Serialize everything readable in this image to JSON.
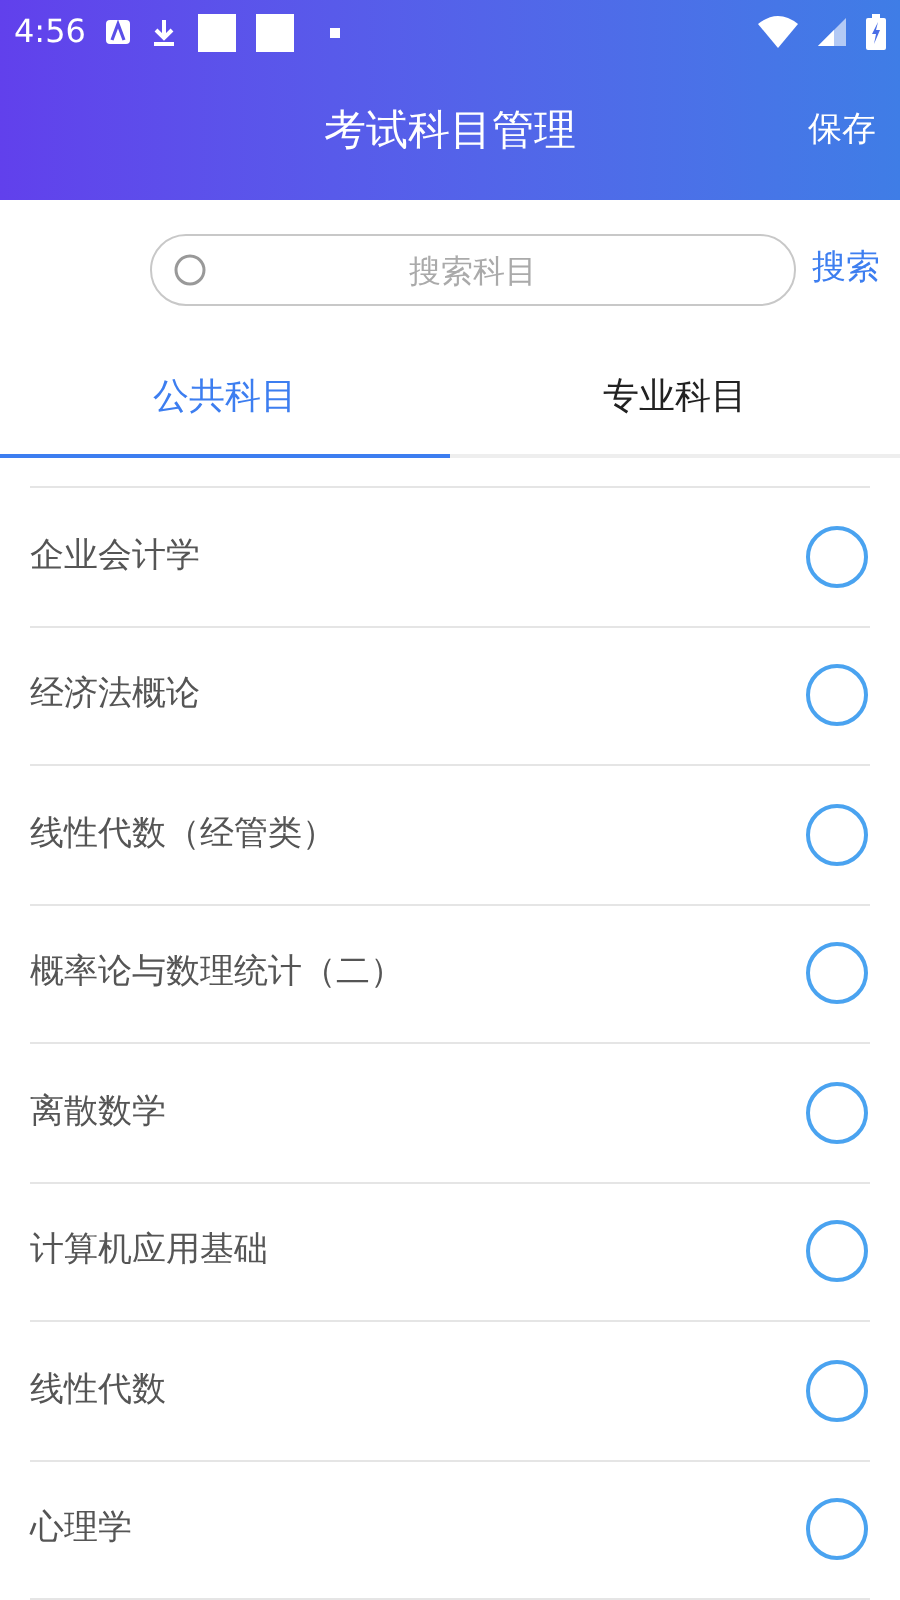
{
  "status_bar": {
    "time": "4:56"
  },
  "header": {
    "title": "考试科目管理",
    "action": "保存"
  },
  "search": {
    "placeholder": "搜索科目",
    "button": "搜索"
  },
  "tabs": [
    {
      "label": "公共科目",
      "selected": true
    },
    {
      "label": "专业科目",
      "selected": false
    }
  ],
  "subjects": [
    {
      "name": "企业会计学",
      "checked": false
    },
    {
      "name": "经济法概论",
      "checked": false
    },
    {
      "name": "线性代数（经管类）",
      "checked": false
    },
    {
      "name": "概率论与数理统计（二）",
      "checked": false
    },
    {
      "name": "离散数学",
      "checked": false
    },
    {
      "name": "计算机应用基础",
      "checked": false
    },
    {
      "name": "线性代数",
      "checked": false
    },
    {
      "name": "心理学",
      "checked": false
    }
  ]
}
